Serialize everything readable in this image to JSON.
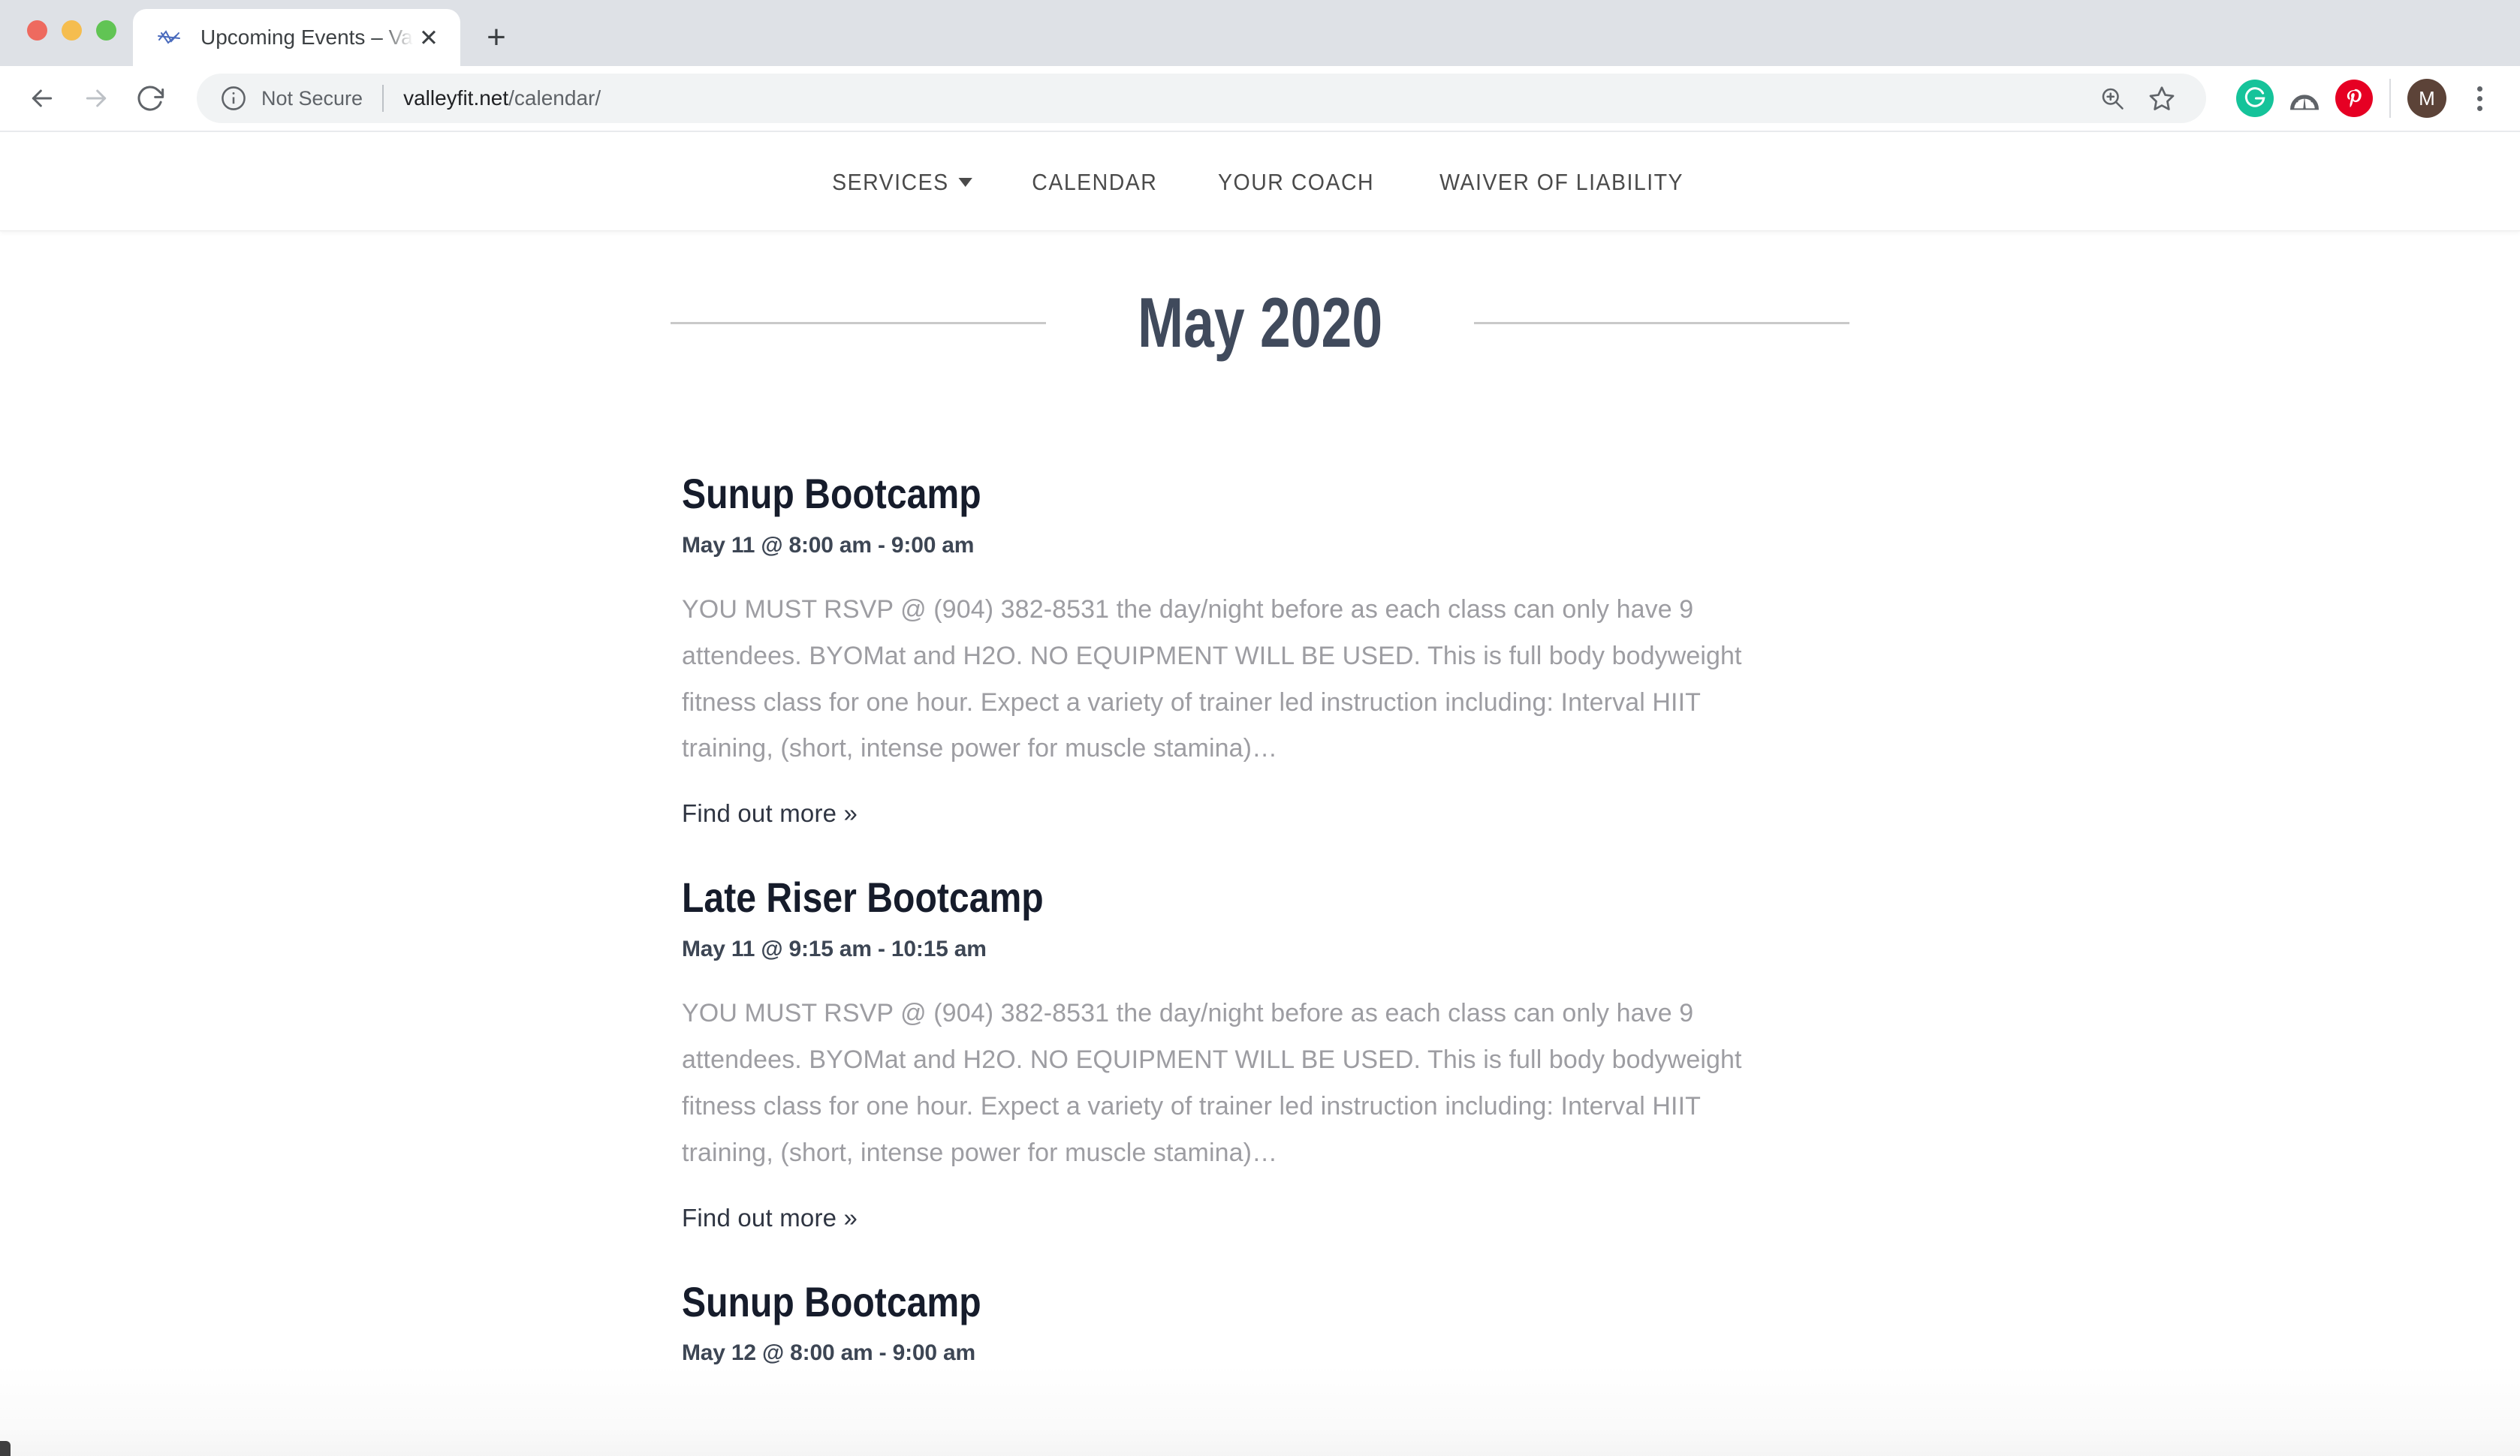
{
  "browser": {
    "window_controls": [
      "close",
      "minimize",
      "maximize"
    ],
    "tab": {
      "title": "Upcoming Events – Valley Fit S",
      "favicon_name": "valley-fit-favicon",
      "close_label": "✕"
    },
    "new_tab_label": "+",
    "back_label": "←",
    "forward_label": "→",
    "reload_label": "⟳",
    "security_label": "Not Secure",
    "url": {
      "host": "valleyfit.net",
      "path": "/calendar/"
    },
    "omnibox_icons": [
      "zoom-in-icon",
      "bookmark-star-icon"
    ],
    "extensions": [
      {
        "name": "grammarly-extension",
        "label": "G",
        "color": "#15c39a"
      },
      {
        "name": "speedometer-extension",
        "label": "",
        "color": "#5f6368"
      },
      {
        "name": "pinterest-extension",
        "label": "P",
        "color": "#e60023"
      }
    ],
    "profile": {
      "initial": "M",
      "color": "#5c4338"
    },
    "menu_label": "⋮"
  },
  "site": {
    "nav": [
      {
        "label": "SERVICES",
        "has_dropdown": true
      },
      {
        "label": "CALENDAR",
        "has_dropdown": false
      },
      {
        "label": "YOUR COACH",
        "has_dropdown": false
      },
      {
        "label": "WAIVER OF LIABILITY",
        "has_dropdown": false
      }
    ],
    "month_title": "May 2020",
    "events": [
      {
        "title": "Sunup Bootcamp",
        "date": "May 11 @ 8:00 am - 9:00 am",
        "description": "YOU MUST RSVP @ (904) 382-8531 the day/night before as each class can only have 9 attendees.  BYOMat and H2O.  NO EQUIPMENT WILL BE USED.  This is full body bodyweight fitness class for one hour.  Expect a variety of trainer led instruction including:   Interval HIIT training, (short, intense power for muscle stamina)…",
        "link": "Find out more »"
      },
      {
        "title": "Late Riser Bootcamp",
        "date": "May 11 @ 9:15 am - 10:15 am",
        "description": "YOU MUST RSVP @ (904) 382-8531 the day/night before as each class can only have 9 attendees.  BYOMat and H2O.  NO EQUIPMENT WILL BE USED.  This is full body bodyweight fitness class for one hour.  Expect a variety of trainer led instruction including:   Interval HIIT training, (short, intense power for muscle stamina)…",
        "link": "Find out more »"
      },
      {
        "title": "Sunup Bootcamp",
        "date": "May 12 @ 8:00 am - 9:00 am",
        "description": "",
        "link": ""
      }
    ]
  },
  "colors": {
    "month_title": "#404a5c",
    "event_title": "#161c2b",
    "event_date": "#3d4654",
    "event_desc": "#9d9da2",
    "event_link": "#2f3542",
    "rule": "#c9c9c9"
  }
}
